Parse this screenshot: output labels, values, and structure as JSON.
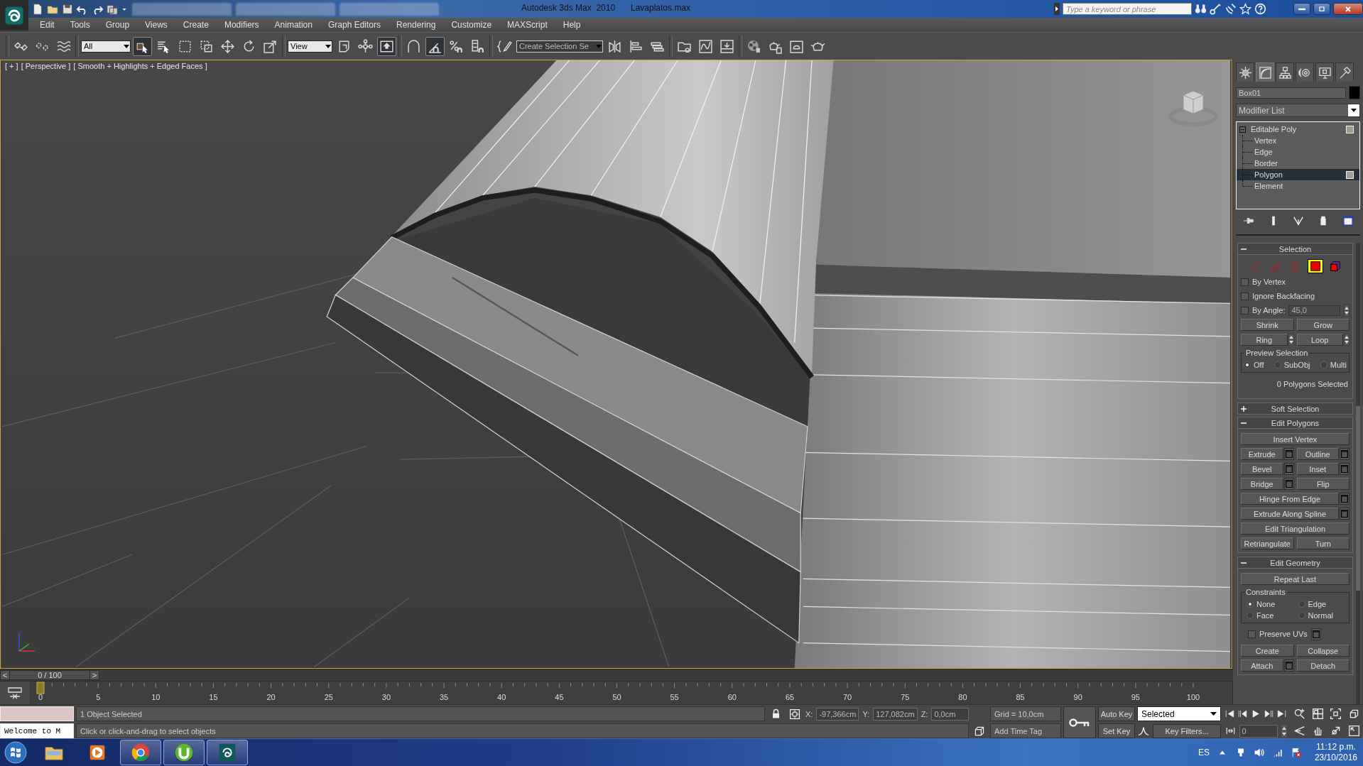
{
  "title_bar": {
    "title": "Autodesk 3ds Max  2010",
    "file_name": "Lavaplatos.max",
    "search": {
      "placeholder": "Type a keyword or phrase"
    }
  },
  "menu": [
    "Edit",
    "Tools",
    "Group",
    "Views",
    "Create",
    "Modifiers",
    "Animation",
    "Graph Editors",
    "Rendering",
    "Customize",
    "MAXScript",
    "Help"
  ],
  "toolbar": {
    "items": [
      {
        "kind": "link",
        "pressed": false
      },
      {
        "kind": "unlink",
        "pressed": false
      },
      {
        "kind": "bind",
        "pressed": false
      },
      {
        "kind": "dropdown",
        "value": "All"
      },
      {
        "kind": "select",
        "pressed": true
      },
      {
        "kind": "select-by-name",
        "pressed": false
      },
      {
        "kind": "region",
        "pressed": false
      },
      {
        "kind": "crossing",
        "pressed": false
      },
      {
        "kind": "move",
        "pressed": false
      },
      {
        "kind": "rotate",
        "pressed": false
      },
      {
        "kind": "scale",
        "pressed": false
      },
      {
        "kind": "dropdown",
        "value": "View"
      },
      {
        "kind": "pivot",
        "pressed": false
      },
      {
        "kind": "manipulate",
        "pressed": false
      },
      {
        "kind": "keyboard",
        "pressed": true
      },
      {
        "kind": "snap",
        "pressed": false
      },
      {
        "kind": "angle-snap",
        "pressed": true
      },
      {
        "kind": "percent-snap",
        "pressed": false
      },
      {
        "kind": "spinner-snap",
        "pressed": false
      },
      {
        "kind": "named-selection",
        "pressed": false
      },
      {
        "kind": "dropdown",
        "value": "Create Selection Se"
      },
      {
        "kind": "mirror",
        "pressed": false
      },
      {
        "kind": "align",
        "pressed": false
      },
      {
        "kind": "layers",
        "pressed": false
      },
      {
        "kind": "schematic",
        "pressed": false
      },
      {
        "kind": "curve-editor",
        "pressed": false
      },
      {
        "kind": "dope-sheet",
        "pressed": false
      },
      {
        "kind": "material-editor",
        "pressed": false
      },
      {
        "kind": "render-setup",
        "pressed": false
      },
      {
        "kind": "rendered-frame",
        "pressed": false
      },
      {
        "kind": "render",
        "pressed": false
      }
    ]
  },
  "viewport": {
    "labels": [
      "[ + ]",
      "[ Perspective ]",
      "[ Smooth + Highlights + Edged Faces ]"
    ]
  },
  "command_panel": {
    "tabs": [
      {
        "kind": "create",
        "selected": false
      },
      {
        "kind": "modify",
        "selected": true
      },
      {
        "kind": "hierarchy",
        "selected": false
      },
      {
        "kind": "motion",
        "selected": false
      },
      {
        "kind": "display",
        "selected": false
      },
      {
        "kind": "utilities",
        "selected": false
      }
    ],
    "object_name": "Box01",
    "modifier_list": "Modifier List",
    "stack": [
      {
        "label": "Editable Poly",
        "expanded": true,
        "selected": false,
        "children": [
          {
            "label": "Vertex",
            "selected": false
          },
          {
            "label": "Edge",
            "selected": false
          },
          {
            "label": "Border",
            "selected": false
          },
          {
            "label": "Polygon",
            "selected": true
          },
          {
            "label": "Element",
            "selected": false
          }
        ]
      }
    ],
    "rollouts": [
      {
        "kind": "selection",
        "title": "Selection",
        "expanded": true,
        "levels": [
          {
            "kind": "vertex",
            "selected": false
          },
          {
            "kind": "edge",
            "selected": false
          },
          {
            "kind": "border",
            "selected": false
          },
          {
            "kind": "polygon",
            "selected": true
          },
          {
            "kind": "element",
            "selected": false
          }
        ],
        "options": [
          {
            "label": "By Vertex",
            "checked": false
          },
          {
            "label": "Ignore Backfacing",
            "checked": false
          },
          {
            "label": "By Angle:",
            "checked": false,
            "value": "45,0"
          }
        ],
        "buttons": [
          {
            "label": "Shrink",
            "kind": "plain"
          },
          {
            "label": "Grow",
            "kind": "plain"
          },
          {
            "label": "Ring",
            "kind": "spinner"
          },
          {
            "label": "Loop",
            "kind": "spinner"
          }
        ],
        "preview": {
          "title": "Preview Selection",
          "options": [
            {
              "label": "Off",
              "selected": true
            },
            {
              "label": "SubObj",
              "selected": false
            },
            {
              "label": "Multi",
              "selected": false
            }
          ]
        },
        "status": "0 Polygons Selected"
      },
      {
        "title": "Soft Selection",
        "expanded": false
      },
      {
        "kind": "edit_polygons",
        "title": "Edit Polygons",
        "expanded": true,
        "rows": [
          [
            {
              "label": "Insert Vertex",
              "settings": false
            }
          ],
          [
            {
              "label": "Extrude",
              "settings": true
            },
            {
              "label": "Outline",
              "settings": true
            }
          ],
          [
            {
              "label": "Bevel",
              "settings": true
            },
            {
              "label": "Inset",
              "settings": true
            }
          ],
          [
            {
              "label": "Bridge",
              "settings": true
            },
            {
              "label": "Flip",
              "settings": false
            }
          ],
          [
            {
              "label": "Hinge From Edge",
              "settings": true
            }
          ],
          [
            {
              "label": "Extrude Along Spline",
              "settings": true
            }
          ],
          [
            {
              "label": "Edit Triangulation",
              "settings": false
            }
          ],
          [
            {
              "label": "Retriangulate",
              "settings": false
            },
            {
              "label": "Turn",
              "settings": false
            }
          ]
        ]
      },
      {
        "kind": "edit_geometry",
        "title": "Edit Geometry",
        "expanded": true,
        "repeat": "Repeat Last",
        "constraints": {
          "title": "Constraints",
          "options": [
            {
              "label": "None",
              "selected": true
            },
            {
              "label": "Edge",
              "selected": false
            },
            {
              "label": "Face",
              "selected": false
            },
            {
              "label": "Normal",
              "selected": false
            }
          ]
        },
        "preserve_uvs": {
          "label": "Preserve UVs",
          "checked": false
        },
        "rows": [
          [
            {
              "label": "Create",
              "settings": false
            },
            {
              "label": "Collapse",
              "settings": false
            }
          ],
          [
            {
              "label": "Attach",
              "settings": true
            },
            {
              "label": "Detach",
              "settings": false
            }
          ]
        ]
      }
    ]
  },
  "timeline": {
    "prev": "<",
    "next": ">",
    "position": "0 / 100",
    "level": 0,
    "ticks": [
      "0",
      "5",
      "10",
      "15",
      "20",
      "25",
      "30",
      "35",
      "40",
      "45",
      "50",
      "55",
      "60",
      "65",
      "70",
      "75",
      "80",
      "85",
      "90",
      "95",
      "100"
    ]
  },
  "status_bar": {
    "listener": "Welcome to M",
    "selection_status": "1 Object Selected",
    "prompt": "Click or click-and-drag to select objects",
    "coords": [
      {
        "axis": "X:",
        "value": "-97,366cm"
      },
      {
        "axis": "Y:",
        "value": "127,082cm"
      },
      {
        "axis": "Z:",
        "value": "0,0cm"
      }
    ],
    "grid": "Grid = 10,0cm",
    "time_tag": "Add Time Tag",
    "auto_key": "Auto Key",
    "set_key": "Set Key",
    "key_mode": "Selected",
    "key_filters": "Key Filters...",
    "frame": "0"
  },
  "taskbar": {
    "apps": [
      {
        "kind": "explorer",
        "running": false
      },
      {
        "kind": "media",
        "running": false
      },
      {
        "kind": "browser",
        "running": true
      },
      {
        "kind": "torrent",
        "running": true
      },
      {
        "kind": "max",
        "running": true
      }
    ],
    "language": "ES",
    "time": "11:12 p.m.",
    "date": "23/10/2016"
  }
}
